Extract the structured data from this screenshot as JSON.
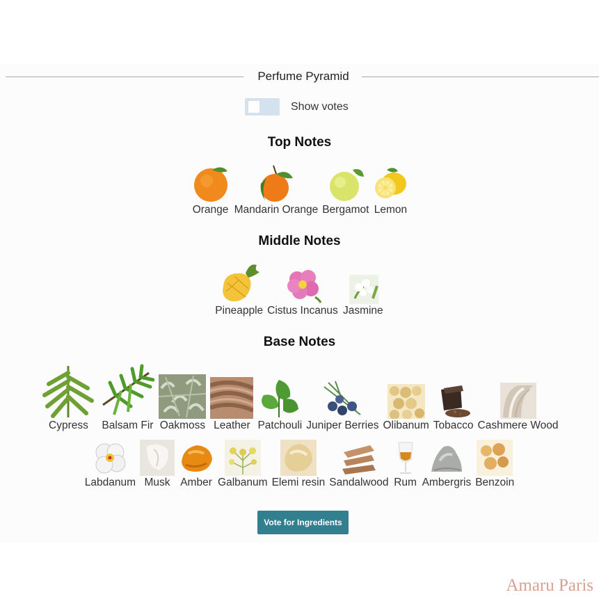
{
  "pyramid": {
    "title": "Perfume Pyramid",
    "toggle_label": "Show votes",
    "vote_button_label": "Vote for Ingredients"
  },
  "sections": {
    "top": {
      "title": "Top Notes",
      "notes": [
        {
          "label": "Orange",
          "icon": "orange-icon"
        },
        {
          "label": "Mandarin Orange",
          "icon": "mandarin-icon"
        },
        {
          "label": "Bergamot",
          "icon": "bergamot-icon"
        },
        {
          "label": "Lemon",
          "icon": "lemon-icon"
        }
      ]
    },
    "middle": {
      "title": "Middle Notes",
      "notes": [
        {
          "label": "Pineapple",
          "icon": "pineapple-icon"
        },
        {
          "label": "Cistus Incanus",
          "icon": "cistus-flower-icon"
        },
        {
          "label": "Jasmine",
          "icon": "jasmine-icon"
        }
      ]
    },
    "base": {
      "title": "Base Notes",
      "notes": [
        {
          "label": "Cypress",
          "icon": "cypress-icon"
        },
        {
          "label": "Balsam Fir",
          "icon": "fir-icon"
        },
        {
          "label": "Oakmoss",
          "icon": "oakmoss-icon"
        },
        {
          "label": "Leather",
          "icon": "leather-icon"
        },
        {
          "label": "Patchouli",
          "icon": "patchouli-icon"
        },
        {
          "label": "Juniper Berries",
          "icon": "juniper-icon"
        },
        {
          "label": "Olibanum",
          "icon": "olibanum-icon"
        },
        {
          "label": "Tobacco",
          "icon": "tobacco-icon"
        },
        {
          "label": "Cashmere Wood",
          "icon": "cashmere-wood-icon"
        },
        {
          "label": "Labdanum",
          "icon": "labdanum-icon"
        },
        {
          "label": "Musk",
          "icon": "musk-icon"
        },
        {
          "label": "Amber",
          "icon": "amber-icon"
        },
        {
          "label": "Galbanum",
          "icon": "galbanum-icon"
        },
        {
          "label": "Elemi resin",
          "icon": "elemi-resin-icon"
        },
        {
          "label": "Sandalwood",
          "icon": "sandalwood-icon"
        },
        {
          "label": "Rum",
          "icon": "rum-icon"
        },
        {
          "label": "Ambergris",
          "icon": "ambergris-icon"
        },
        {
          "label": "Benzoin",
          "icon": "benzoin-icon"
        }
      ]
    }
  },
  "watermark": "Amaru Paris",
  "colors": {
    "button": "#32808f",
    "toggle_track": "#d4e2ef",
    "watermark": "#d9a095"
  }
}
